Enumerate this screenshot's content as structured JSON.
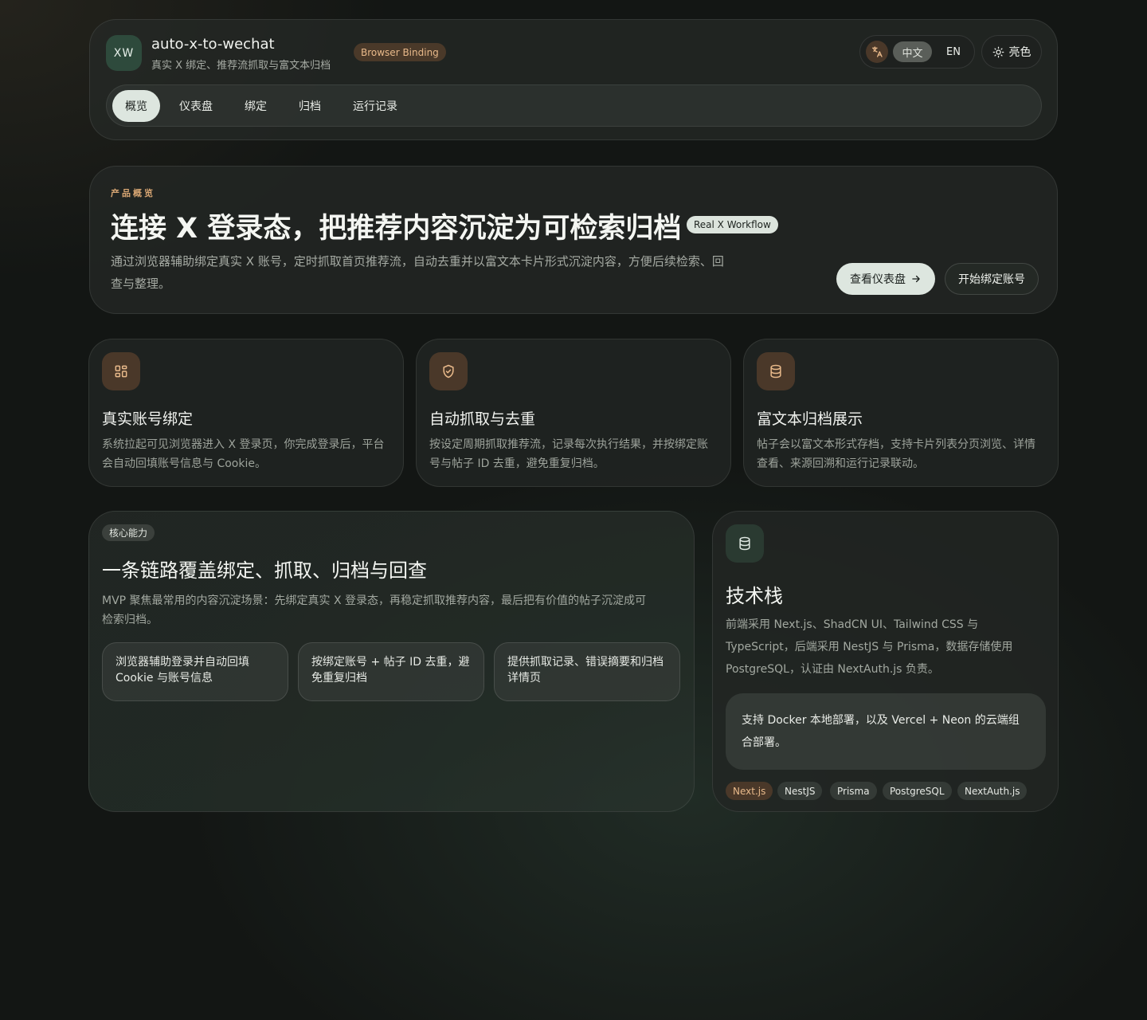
{
  "header": {
    "logo": "XW",
    "app_name": "auto-x-to-wechat",
    "subtitle": "真实 X 绑定、推荐流抓取与富文本归档",
    "badge": "Browser Binding",
    "lang_icon": "translate-icon",
    "lang_zh": "中文",
    "lang_en": "EN",
    "theme_icon": "sun-icon",
    "theme_label": "亮色",
    "tabs": [
      {
        "label": "概览",
        "active": true
      },
      {
        "label": "仪表盘",
        "active": false
      },
      {
        "label": "绑定",
        "active": false
      },
      {
        "label": "归档",
        "active": false
      },
      {
        "label": "运行记录",
        "active": false
      }
    ]
  },
  "hero": {
    "eyebrow": "产品概览",
    "title": "连接 X 登录态，把推荐内容沉淀为可检索归档",
    "badge": "Real X Workflow",
    "description": "通过浏览器辅助绑定真实 X 账号，定时抓取首页推荐流，自动去重并以富文本卡片形式沉淀内容，方便后续检索、回查与整理。",
    "primary_button": "查看仪表盘",
    "primary_icon": "arrow-right-icon",
    "secondary_button": "开始绑定账号"
  },
  "features": [
    {
      "icon": "grid-icon",
      "title": "真实账号绑定",
      "description": "系统拉起可见浏览器进入 X 登录页，你完成登录后，平台会自动回填账号信息与 Cookie。"
    },
    {
      "icon": "shield-check-icon",
      "title": "自动抓取与去重",
      "description": "按设定周期抓取推荐流，记录每次执行结果，并按绑定账号与帖子 ID 去重，避免重复归档。"
    },
    {
      "icon": "database-icon",
      "title": "富文本归档展示",
      "description": "帖子会以富文本形式存档，支持卡片列表分页浏览、详情查看、来源回溯和运行记录联动。"
    }
  ],
  "core": {
    "pill": "核心能力",
    "title": "一条链路覆盖绑定、抓取、归档与回查",
    "description": "MVP 聚焦最常用的内容沉淀场景：先绑定真实 X 登录态，再稳定抓取推荐内容，最后把有价值的帖子沉淀成可检索归档。",
    "items": [
      "浏览器辅助登录并自动回填 Cookie 与账号信息",
      "按绑定账号 + 帖子 ID 去重，避免重复归档",
      "提供抓取记录、错误摘要和归档详情页"
    ]
  },
  "tech": {
    "icon": "database-icon",
    "title": "技术栈",
    "description": "前端采用 Next.js、ShadCN UI、Tailwind CSS 与 TypeScript，后端采用 NestJS 与 Prisma，数据存储使用 PostgreSQL，认证由 NextAuth.js 负责。",
    "note": "支持 Docker 本地部署，以及 Vercel + Neon 的云端组合部署。",
    "tags": [
      "Next.js",
      "NestJS",
      "Prisma",
      "PostgreSQL",
      "NextAuth.js"
    ]
  },
  "colors": {
    "background": "#131614",
    "accent": "#e8b98a",
    "primary_button": "#dde6df",
    "logo_bg": "#2e4a3c"
  }
}
